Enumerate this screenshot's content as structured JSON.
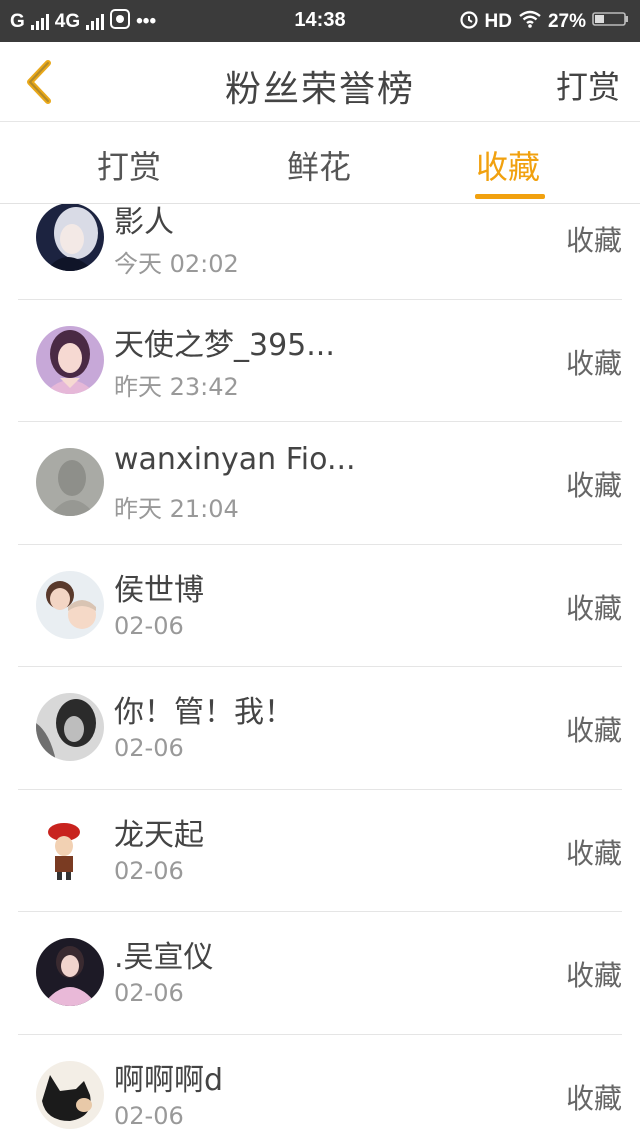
{
  "status_bar": {
    "carrier1": "G",
    "carrier2": "4G",
    "dots": "•••",
    "time": "14:38",
    "hd": "HD",
    "battery": "27%"
  },
  "header": {
    "back_icon": "chevron-left-icon",
    "title": "粉丝荣誉榜",
    "action": "打赏",
    "accent_color": "#f1a10f"
  },
  "tabs": [
    {
      "label": "打赏",
      "active": false
    },
    {
      "label": "鲜花",
      "active": false
    },
    {
      "label": "收藏",
      "active": true
    }
  ],
  "list": [
    {
      "name": "影人",
      "time": "今天 02:02",
      "action": "收藏",
      "avatar": "avatar-dark-portrait"
    },
    {
      "name": "天使之梦_395...",
      "time": "昨天 23:42",
      "action": "收藏",
      "avatar": "avatar-girl-purple"
    },
    {
      "name": "wanxinyan Fio...",
      "time": "昨天 21:04",
      "action": "收藏",
      "avatar": "avatar-gray-blur"
    },
    {
      "name": "侯世博",
      "time": "02-06",
      "action": "收藏",
      "avatar": "avatar-mother-child"
    },
    {
      "name": "你！管！我！",
      "time": "02-06",
      "action": "收藏",
      "avatar": "avatar-bw-photo"
    },
    {
      "name": "龙天起",
      "time": "02-06",
      "action": "收藏",
      "avatar": "avatar-cartoon-red-hat"
    },
    {
      "name": ".吴宣仪",
      "time": "02-06",
      "action": "收藏",
      "avatar": "avatar-girl-pink"
    },
    {
      "name": "啊啊啊d",
      "time": "02-06",
      "action": "收藏",
      "avatar": "avatar-black-cat"
    }
  ]
}
